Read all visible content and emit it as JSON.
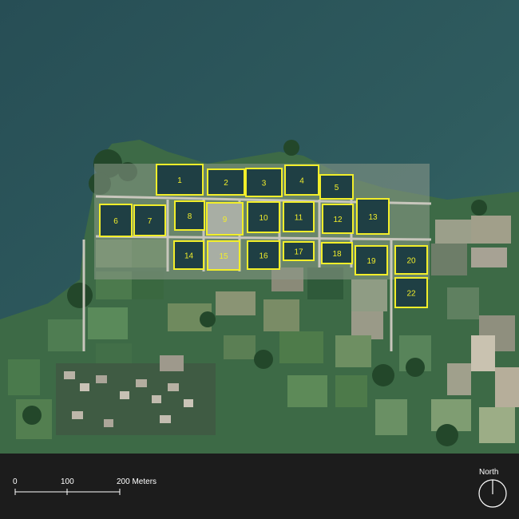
{
  "map": {
    "plots": [
      {
        "label": "1"
      },
      {
        "label": "2"
      },
      {
        "label": "3"
      },
      {
        "label": "4"
      },
      {
        "label": "5"
      },
      {
        "label": "6"
      },
      {
        "label": "7"
      },
      {
        "label": "8"
      },
      {
        "label": "9"
      },
      {
        "label": "10"
      },
      {
        "label": "11"
      },
      {
        "label": "12"
      },
      {
        "label": "13"
      },
      {
        "label": "14"
      },
      {
        "label": "15"
      },
      {
        "label": "16"
      },
      {
        "label": "17"
      },
      {
        "label": "18"
      },
      {
        "label": "19"
      },
      {
        "label": "20"
      },
      {
        "label": "22"
      }
    ],
    "colors": {
      "water": "#2f5c5f",
      "outline": "#f2ee2a",
      "land": "#3d6a46",
      "footer": "#1c1c1c"
    }
  },
  "scale_bar": {
    "tick_0": "0",
    "tick_100": "100",
    "tick_200": "200 Meters"
  },
  "north_arrow": {
    "label": "North",
    "icon": "north-arrow-icon"
  }
}
